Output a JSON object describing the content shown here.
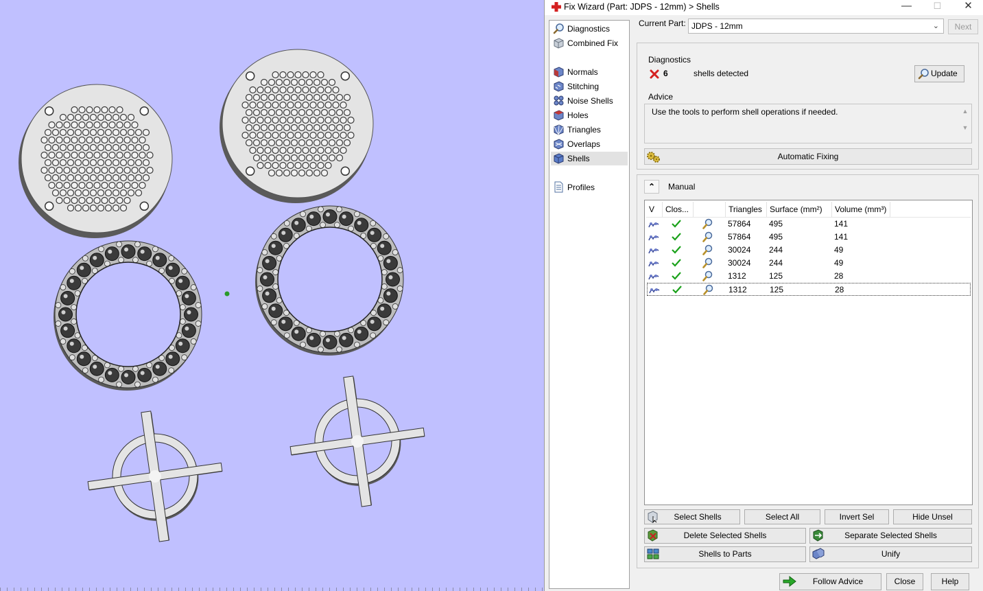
{
  "window": {
    "title": "Fix Wizard (Part: JDPS - 12mm) > Shells",
    "minimize": "—",
    "maximize": "☐",
    "close": "✕"
  },
  "nav": {
    "items": [
      {
        "label": "Diagnostics",
        "icon": "magnifier-icon"
      },
      {
        "label": "Combined Fix",
        "icon": "cube-gray-icon"
      },
      {
        "label": "Normals",
        "icon": "cube-normals-icon"
      },
      {
        "label": "Stitching",
        "icon": "cube-stitching-icon"
      },
      {
        "label": "Noise Shells",
        "icon": "noise-shells-icon"
      },
      {
        "label": "Holes",
        "icon": "cube-holes-icon"
      },
      {
        "label": "Triangles",
        "icon": "triangles-icon"
      },
      {
        "label": "Overlaps",
        "icon": "overlaps-icon"
      },
      {
        "label": "Shells",
        "icon": "shells-icon"
      },
      {
        "label": "Profiles",
        "icon": "document-icon"
      }
    ],
    "selected": "Shells"
  },
  "current_part": {
    "label": "Current Part:",
    "value": "JDPS - 12mm",
    "next_label": "Next"
  },
  "diagnostics": {
    "heading": "Diagnostics",
    "count": "6",
    "status_text": "shells detected",
    "update_label": "Update",
    "advice_heading": "Advice",
    "advice_text": "Use the tools to perform shell operations if needed.",
    "autofix_label": "Automatic Fixing"
  },
  "manual": {
    "heading": "Manual",
    "columns": [
      "V",
      "Clos...",
      "",
      "Triangles",
      "Surface (mm²)",
      "Volume (mm³)"
    ],
    "rows": [
      {
        "triangles": "57864",
        "surface": "495",
        "volume": "141",
        "closed": true
      },
      {
        "triangles": "57864",
        "surface": "495",
        "volume": "141",
        "closed": true
      },
      {
        "triangles": "30024",
        "surface": "244",
        "volume": "49",
        "closed": true
      },
      {
        "triangles": "30024",
        "surface": "244",
        "volume": "49",
        "closed": true
      },
      {
        "triangles": "1312",
        "surface": "125",
        "volume": "28",
        "closed": true
      },
      {
        "triangles": "1312",
        "surface": "125",
        "volume": "28",
        "closed": true
      }
    ],
    "selected_row": 5,
    "buttons": {
      "select_shells": "Select Shells",
      "select_all": "Select All",
      "invert_sel": "Invert Sel",
      "hide_unsel": "Hide Unsel",
      "delete_selected": "Delete Selected Shells",
      "separate_selected": "Separate Selected Shells",
      "shells_to_parts": "Shells to Parts",
      "unify": "Unify"
    }
  },
  "footer": {
    "follow_advice": "Follow Advice",
    "close": "Close",
    "help": "Help"
  },
  "colors": {
    "viewport_bg": "#c0c0ff",
    "part_face": "#e4e4e4",
    "part_side": "#5a5a5a",
    "ball_dark": "#3a3a3a",
    "error_red": "#d42020",
    "check_green": "#1aa11a"
  }
}
